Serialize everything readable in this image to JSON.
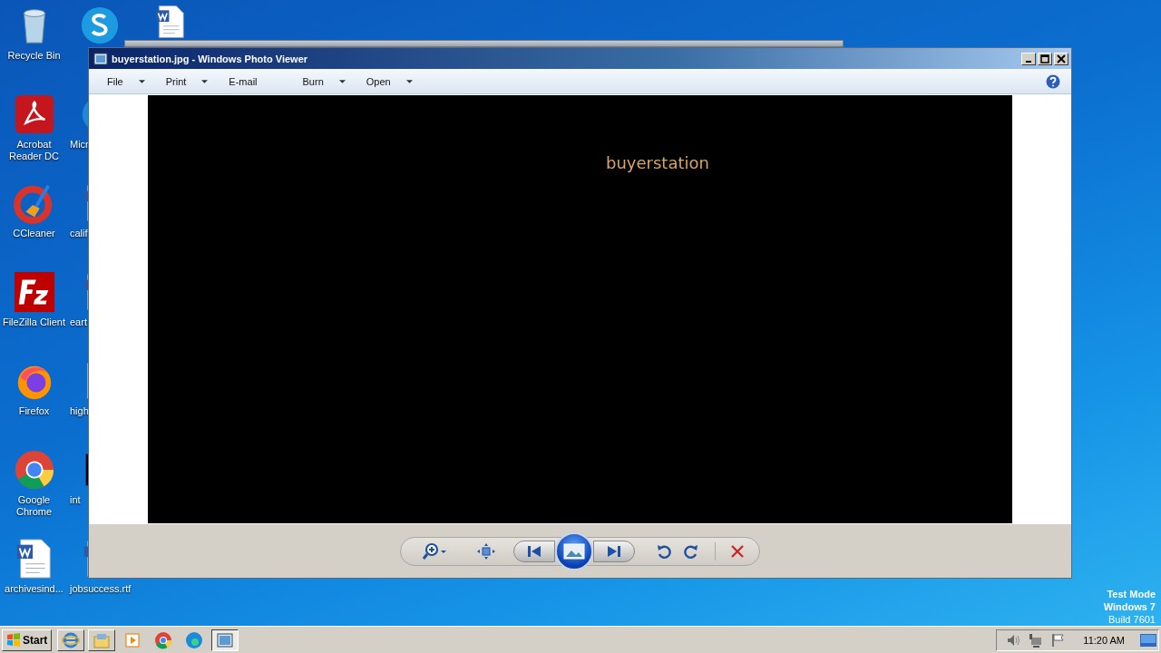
{
  "desktop_columns": [
    [
      {
        "label": "Recycle Bin",
        "kind": "recycle"
      },
      {
        "label": "Acrobat Reader DC",
        "kind": "pdf"
      },
      {
        "label": "CCleaner",
        "kind": "ccleaner"
      },
      {
        "label": "FileZilla Client",
        "kind": "filezilla"
      },
      {
        "label": "Firefox",
        "kind": "firefox"
      },
      {
        "label": "Google Chrome",
        "kind": "chrome"
      },
      {
        "label": "archivesind...",
        "kind": "word"
      }
    ],
    [
      {
        "kind": "skype"
      },
      {
        "label": "Micr",
        "kind": "edge"
      },
      {
        "label": "calif",
        "kind": "doc"
      },
      {
        "label": "eart",
        "kind": "doc"
      },
      {
        "label": "high",
        "kind": "blank"
      },
      {
        "label": "int",
        "kind": "black"
      },
      {
        "label": "jobsuccess.rtf",
        "kind": "doc"
      }
    ],
    [
      {
        "kind": "word"
      }
    ]
  ],
  "window": {
    "title": "buyerstation.jpg - Windows Photo Viewer",
    "menu": [
      {
        "label": "File",
        "dropdown": true
      },
      {
        "label": "Print",
        "dropdown": true
      },
      {
        "label": "E-mail",
        "dropdown": false
      },
      {
        "label": "Burn",
        "dropdown": true
      },
      {
        "label": "Open",
        "dropdown": true
      }
    ],
    "image_text": "buyerstation",
    "toolbar": [
      {
        "kind": "zoom"
      },
      {
        "kind": "fit"
      },
      {
        "kind": "previous"
      },
      {
        "kind": "slideshow"
      },
      {
        "kind": "next"
      },
      {
        "kind": "rotate-left"
      },
      {
        "kind": "rotate-right"
      },
      {
        "kind": "delete"
      }
    ]
  },
  "watermark_lines": [
    "Test Mode",
    "Windows 7",
    "Build 7601"
  ],
  "taskbar": {
    "start": "Start",
    "apps": [
      {
        "kind": "ie",
        "selected": false
      },
      {
        "kind": "explorer",
        "selected": false
      },
      {
        "kind": "media",
        "selected": false
      },
      {
        "kind": "chrome",
        "selected": false
      },
      {
        "kind": "edge",
        "selected": false
      },
      {
        "kind": "photo",
        "selected": true
      }
    ],
    "time": "11:20 AM"
  }
}
